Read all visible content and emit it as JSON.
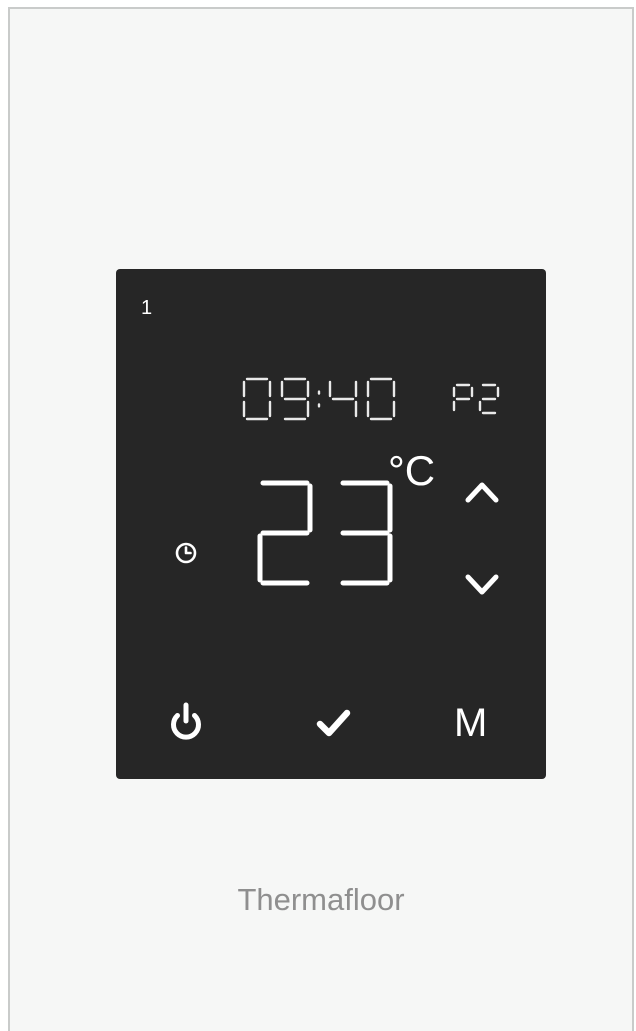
{
  "thermostat": {
    "zone_number": "1",
    "clock_time": "09:40",
    "program": "P2",
    "temperature": "23",
    "temperature_unit": "°C",
    "menu_label": "M",
    "icons": {
      "schedule": "clock-icon",
      "up": "chevron-up-icon",
      "down": "chevron-down-icon",
      "power": "power-icon",
      "confirm": "check-icon"
    }
  },
  "brand": {
    "name": "Thermafloor"
  },
  "colors": {
    "body": "#f6f7f6",
    "screen": "#262626",
    "display_text": "#ffffff",
    "brand_text": "#8f8f8f"
  }
}
